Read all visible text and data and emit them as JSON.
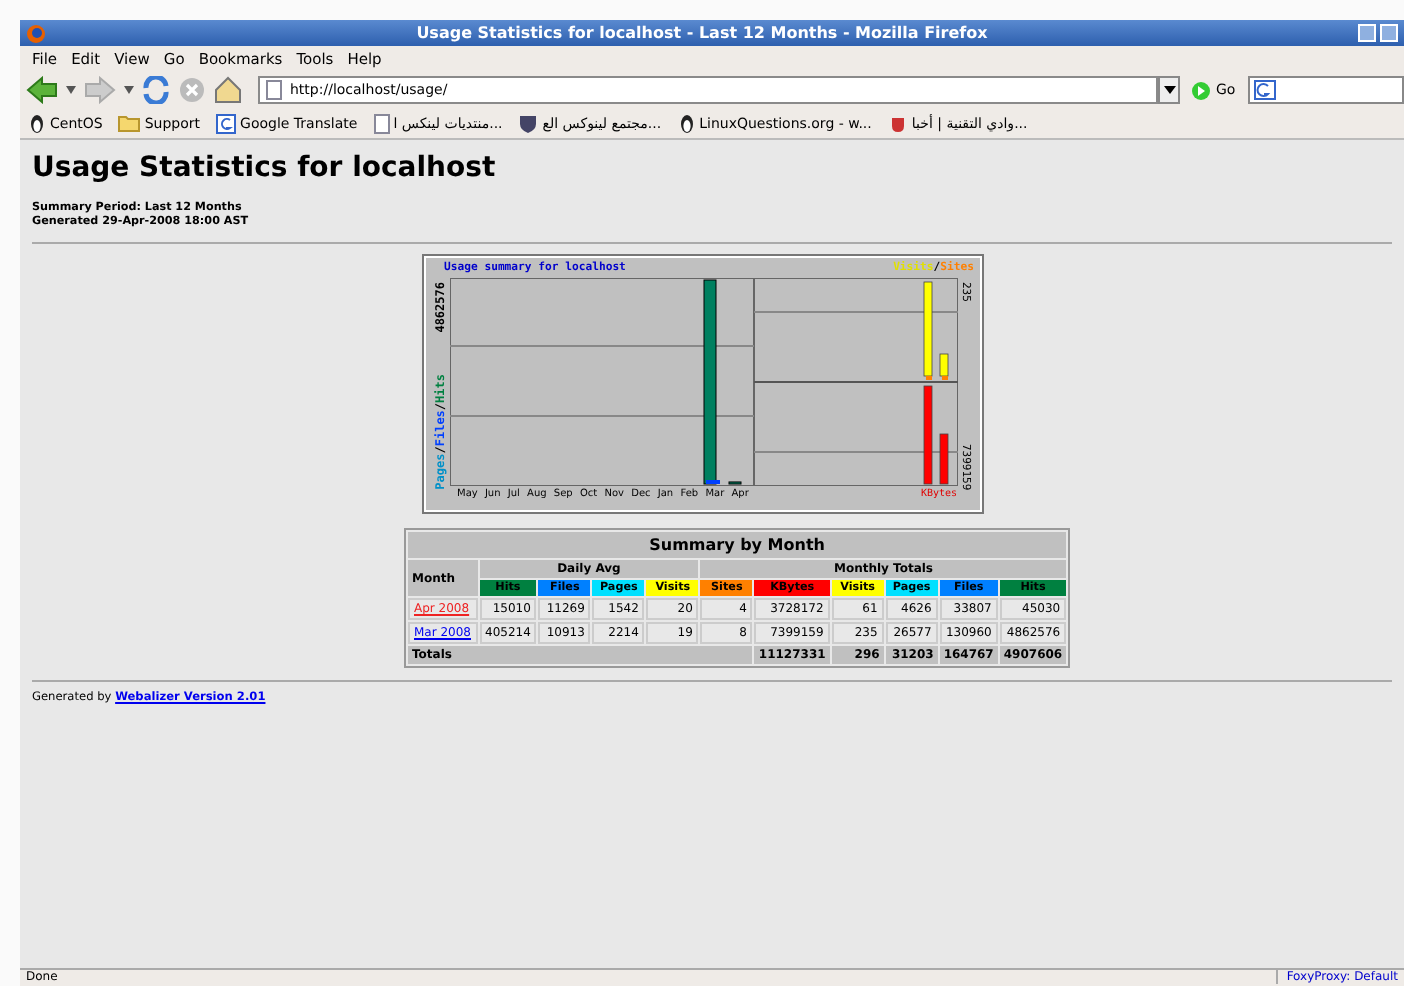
{
  "window": {
    "title": "Usage Statistics for localhost - Last 12 Months - Mozilla Firefox"
  },
  "menu": [
    "File",
    "Edit",
    "View",
    "Go",
    "Bookmarks",
    "Tools",
    "Help"
  ],
  "toolbar": {
    "url": "http://localhost/usage/",
    "go": "Go"
  },
  "bookmarks": [
    {
      "label": "CentOS",
      "kind": "linux"
    },
    {
      "label": "Support",
      "kind": "folder"
    },
    {
      "label": "Google Translate",
      "kind": "google"
    },
    {
      "label": "منتديات لينكس ا...",
      "kind": "page"
    },
    {
      "label": "مجتمع لينوكس الع...",
      "kind": "shield"
    },
    {
      "label": "LinuxQuestions.org - w...",
      "kind": "linux"
    },
    {
      "label": "وادي التقنية | أخبا...",
      "kind": "cup"
    }
  ],
  "page": {
    "heading": "Usage Statistics for localhost",
    "period": "Summary Period: Last 12 Months",
    "generated": "Generated 29-Apr-2008 18:00 AST",
    "graph": {
      "title": "Usage summary for localhost",
      "legend_left": [
        {
          "text": "Pages",
          "color": "#0090c8"
        },
        {
          "text": "/"
        },
        {
          "text": "Files",
          "color": "#0040ff"
        },
        {
          "text": "/"
        },
        {
          "text": "Hits",
          "color": "#008040"
        }
      ],
      "legend_right": [
        {
          "text": "Visits",
          "color": "#e0e000"
        },
        {
          "text": "/"
        },
        {
          "text": "Sites",
          "color": "#ff8000"
        }
      ],
      "max_hits": "4862576",
      "max_visits": "235",
      "max_kbytes": "7399159",
      "kbytes_label": "KBytes",
      "months": [
        "May",
        "Jun",
        "Jul",
        "Aug",
        "Sep",
        "Oct",
        "Nov",
        "Dec",
        "Jan",
        "Feb",
        "Mar",
        "Apr"
      ]
    },
    "table": {
      "title": "Summary by Month",
      "month_header": "Month",
      "daily_avg": "Daily Avg",
      "monthly_totals": "Monthly Totals",
      "columns": [
        {
          "label": "Hits",
          "color": "#008040"
        },
        {
          "label": "Files",
          "color": "#0080ff"
        },
        {
          "label": "Pages",
          "color": "#00e0ff"
        },
        {
          "label": "Visits",
          "color": "#ffff00"
        },
        {
          "label": "Sites",
          "color": "#ff8000"
        },
        {
          "label": "KBytes",
          "color": "#ff0000"
        },
        {
          "label": "Visits",
          "color": "#ffff00"
        },
        {
          "label": "Pages",
          "color": "#00e0ff"
        },
        {
          "label": "Files",
          "color": "#0080ff"
        },
        {
          "label": "Hits",
          "color": "#008040"
        }
      ],
      "rows": [
        {
          "month": "Apr 2008",
          "visited": true,
          "cells": [
            "15010",
            "11269",
            "1542",
            "20",
            "4",
            "3728172",
            "61",
            "4626",
            "33807",
            "45030"
          ]
        },
        {
          "month": "Mar 2008",
          "visited": false,
          "cells": [
            "405214",
            "10913",
            "2214",
            "19",
            "8",
            "7399159",
            "235",
            "26577",
            "130960",
            "4862576"
          ]
        }
      ],
      "totals_label": "Totals",
      "totals": [
        "11127331",
        "296",
        "31203",
        "164767",
        "4907606"
      ]
    },
    "footer": {
      "prefix": "Generated by",
      "link": "Webalizer Version 2.01"
    }
  },
  "status_bar": {
    "text": "Done",
    "proxy": "FoxyProxy: Default"
  }
}
